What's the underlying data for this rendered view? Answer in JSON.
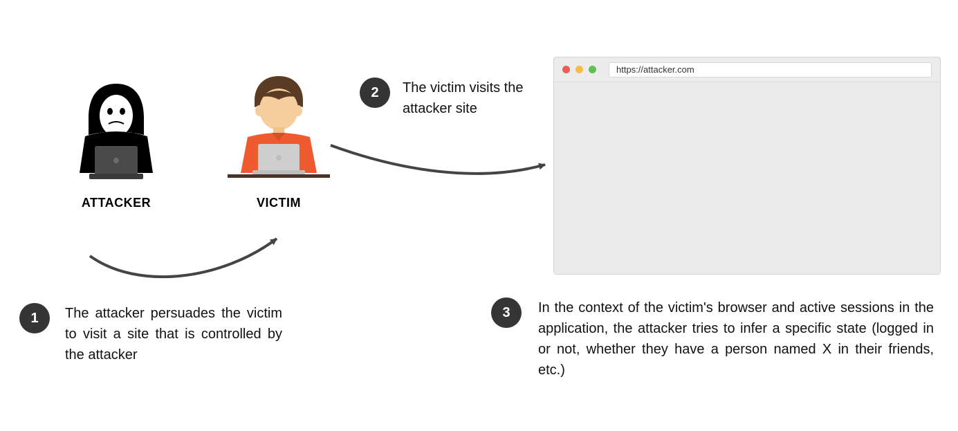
{
  "actors": {
    "attacker_label": "ATTACKER",
    "victim_label": "VICTIM"
  },
  "steps": {
    "s1": {
      "num": "1",
      "text": "The attacker persuades the victim to visit a site that is controlled by the attacker"
    },
    "s2": {
      "num": "2",
      "text": "The victim visits the attacker site"
    },
    "s3": {
      "num": "3",
      "text": "In the context of the victim's browser and active sessions in the application, the attacker tries to infer a specific state (logged in or not, whether they have a person named X in their friends, etc.)"
    }
  },
  "browser": {
    "url": "https://attacker.com"
  }
}
